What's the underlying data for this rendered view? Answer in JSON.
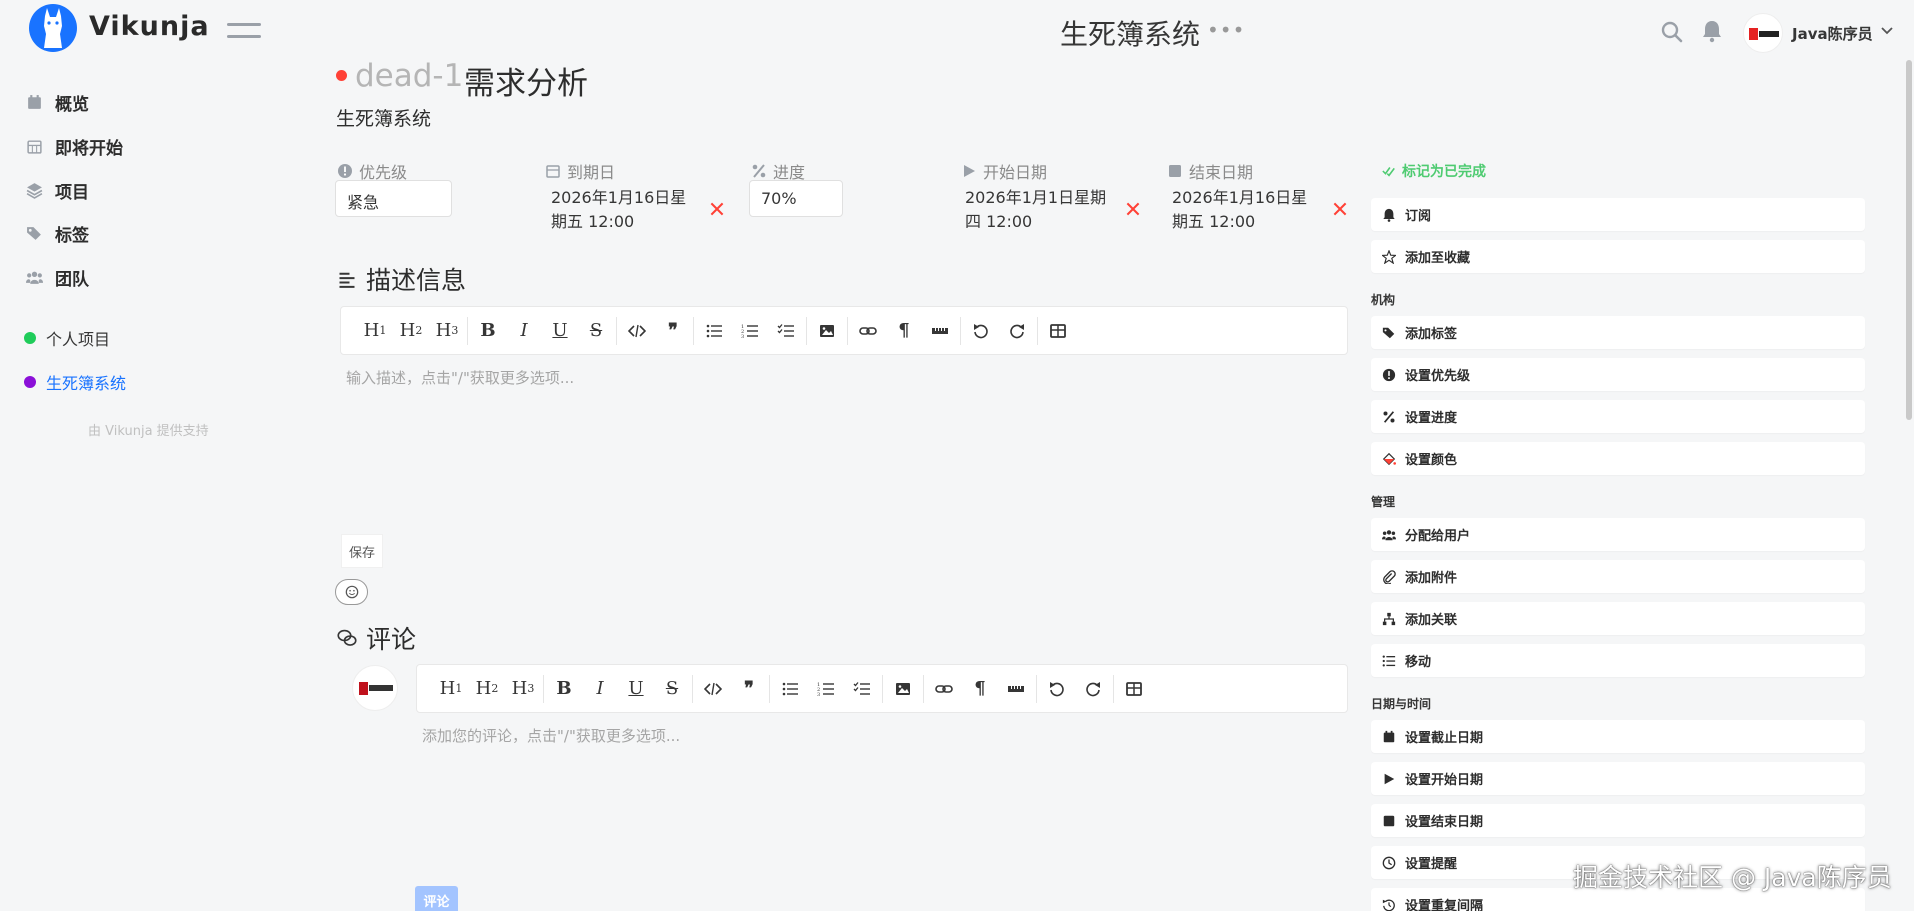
{
  "app": {
    "brand": "Vikunja"
  },
  "topbar": {
    "title": "生死簿系统",
    "more": "•••",
    "user_name": "Java陈序员"
  },
  "sidebar": {
    "nav": [
      {
        "label": "概览",
        "icon": "calendar-icon"
      },
      {
        "label": "即将开始",
        "icon": "calendar-grid-icon"
      },
      {
        "label": "项目",
        "icon": "layers-icon"
      },
      {
        "label": "标签",
        "icon": "tags-icon"
      },
      {
        "label": "团队",
        "icon": "users-icon"
      }
    ],
    "projects": [
      {
        "label": "个人项目",
        "color": "#1fcc5a"
      },
      {
        "label": "生死簿系统",
        "color": "#8b10d8"
      }
    ],
    "powered_by": "由 Vikunja 提供支持"
  },
  "task": {
    "id": "dead-1",
    "title": "需求分析",
    "project": "生死簿系统",
    "priority": {
      "label": "优先级",
      "value": "紧急"
    },
    "due": {
      "label": "到期日",
      "value_line1": "2026年1月16日星",
      "value_line2": "期五 12:00"
    },
    "progress": {
      "label": "进度",
      "value": "70%"
    },
    "start": {
      "label": "开始日期",
      "value_line1": "2026年1月1日星期",
      "value_line2": "四 12:00"
    },
    "end": {
      "label": "结束日期",
      "value_line1": "2026年1月16日星",
      "value_line2": "期五 12:00"
    }
  },
  "description": {
    "title": "描述信息",
    "placeholder": "输入描述，点击\"/\"获取更多选项...",
    "save_label": "保存"
  },
  "comments": {
    "title": "评论",
    "placeholder": "添加您的评论，点击\"/\"获取更多选项...",
    "submit_label": "评论"
  },
  "actions": {
    "mark_done": "标记为已完成",
    "top": [
      "订阅",
      "添加至收藏"
    ],
    "groups": [
      {
        "heading": "机构",
        "items": [
          "添加标签",
          "设置优先级",
          "设置进度",
          "设置颜色"
        ]
      },
      {
        "heading": "管理",
        "items": [
          "分配给用户",
          "添加附件",
          "添加关联",
          "移动"
        ]
      },
      {
        "heading": "日期与时间",
        "items": [
          "设置截止日期",
          "设置开始日期",
          "设置结束日期",
          "设置提醒",
          "设置重复间隔"
        ]
      }
    ]
  },
  "watermark": "掘金技术社区 @ Java陈序员",
  "colors": {
    "accent": "#1973ff",
    "danger": "#ff4136",
    "success": "#4ecb71"
  }
}
